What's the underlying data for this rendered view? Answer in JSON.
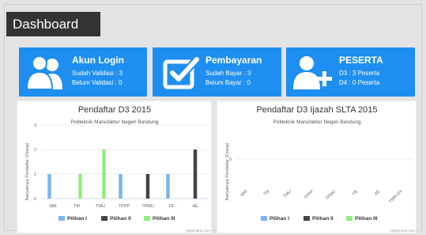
{
  "header": {
    "title": "Dashboard"
  },
  "cards": [
    {
      "title": "Akun Login",
      "line1": "Sudah Validasi : 3",
      "line2": "Belum Validasi : 0",
      "icon": "users-icon"
    },
    {
      "title": "Pembayaran",
      "line1": "Sudah Bayar : 3",
      "line2": "Belum Bayar : 0",
      "icon": "checkbox-icon"
    },
    {
      "title": "PESERTA",
      "line1": "D3 : 3 Peserta",
      "line2": "D4 : 0 Peserta",
      "icon": "add-user-icon"
    }
  ],
  "colors": {
    "accent": "#1e8ff0",
    "pilihan1": "#7cb5ec",
    "pilihan2": "#434348",
    "pilihan3": "#90ed7d"
  },
  "chart_data": [
    {
      "type": "bar",
      "title": "Pendaftar D3 2015",
      "subtitle": "Politeknik Manufaktur Negeri Bandung",
      "ylabel": "Banyaknya Pendaftar (Orang)",
      "xlabel": "",
      "ylim": [
        0,
        3
      ],
      "yticks": [
        "0",
        "1",
        "2",
        "3"
      ],
      "categories": [
        "MM",
        "TM",
        "TMU",
        "TPPP",
        "TPMU",
        "FE",
        "AE"
      ],
      "series": [
        {
          "name": "Pilihan I",
          "values": [
            1,
            0,
            0,
            1,
            0,
            1,
            0
          ]
        },
        {
          "name": "Pilihan II",
          "values": [
            0,
            0,
            0,
            0,
            1,
            0,
            2
          ]
        },
        {
          "name": "Pilihan III",
          "values": [
            0,
            1,
            2,
            0,
            0,
            0,
            0
          ]
        }
      ],
      "legend": "bottom-center",
      "credit": "Highcharts.com"
    },
    {
      "type": "bar",
      "title": "Pendaftar D3 Ijazah SLTA 2015",
      "subtitle": "Politeknik Manufaktur Negeri Bandung",
      "ylabel": "Banyaknya Pendaftar (Orang)",
      "xlabel": "",
      "yticks": [
        "0"
      ],
      "categories": [
        "MM",
        "TM",
        "TMU",
        "TPPP",
        "TPMU",
        "FE",
        "AE",
        "TMR-D4"
      ],
      "series": [
        {
          "name": "Pilihan I",
          "values": []
        },
        {
          "name": "Pilihan II",
          "values": []
        },
        {
          "name": "Pilihan III",
          "values": []
        }
      ],
      "legend": "bottom-center",
      "credit": "Highcharts.com"
    }
  ]
}
